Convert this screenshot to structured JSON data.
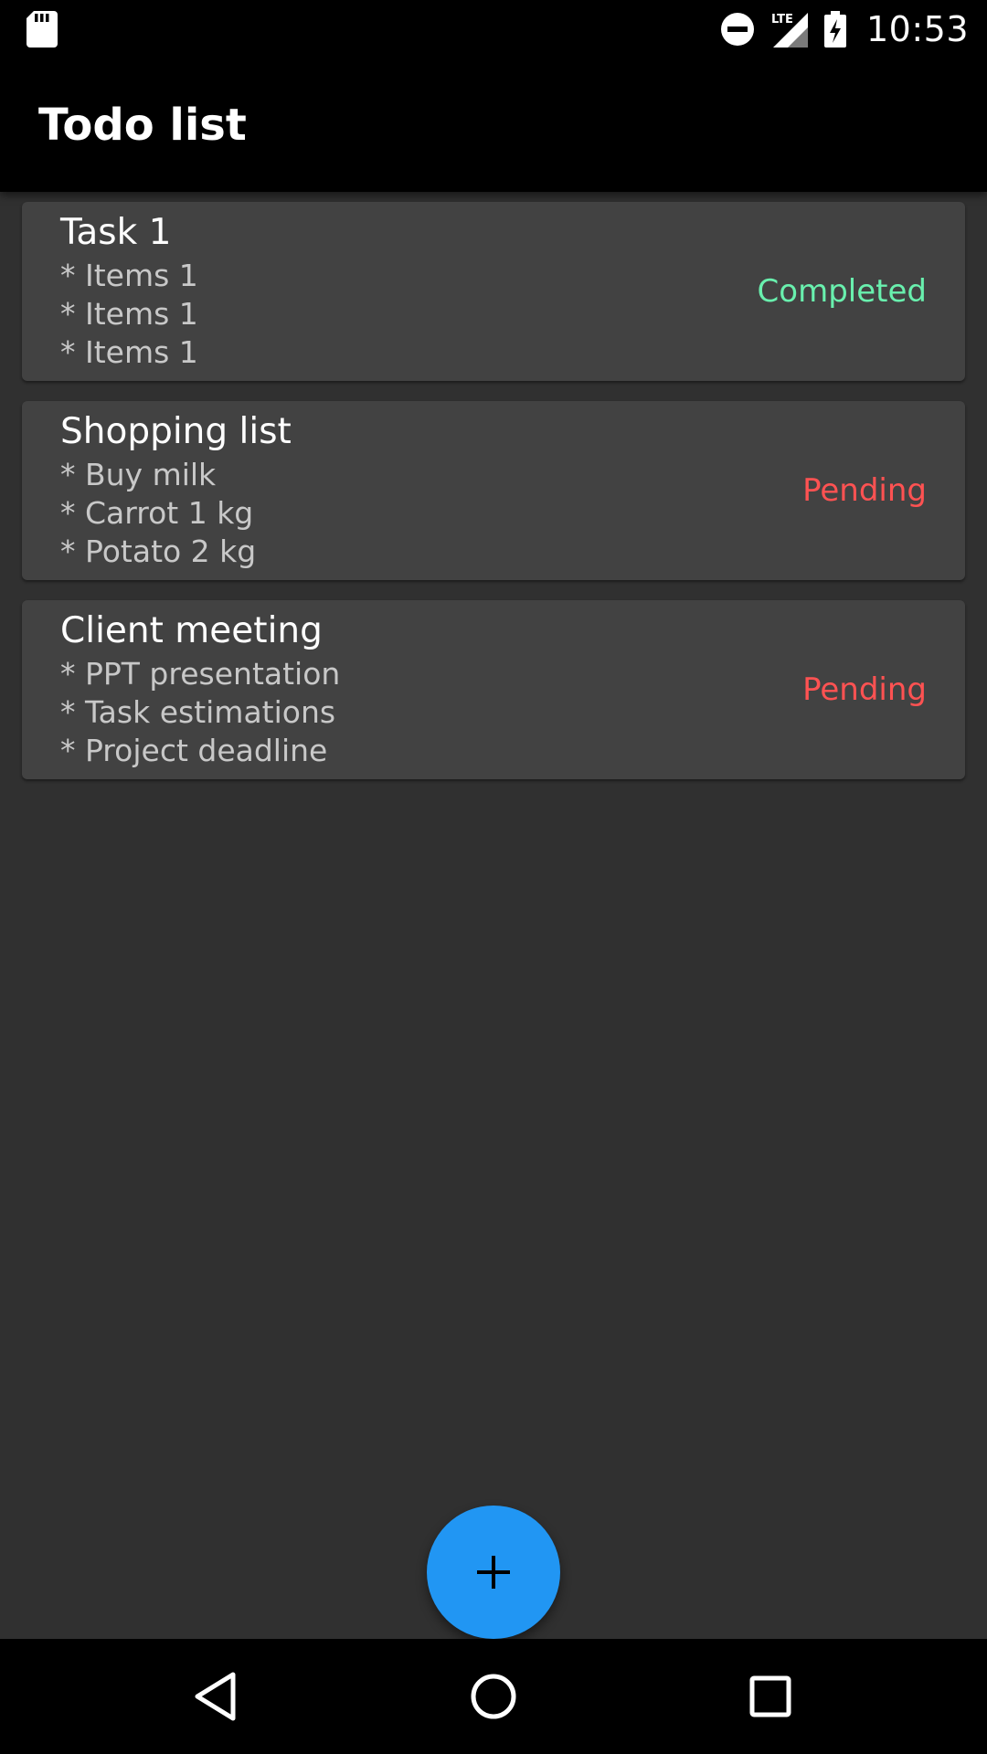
{
  "status_bar": {
    "time": "10:53",
    "network": "LTE",
    "icons": [
      "sd-card-icon",
      "do-not-disturb-icon",
      "signal-icon",
      "battery-charging-icon"
    ]
  },
  "app_bar": {
    "title": "Todo list"
  },
  "tasks": [
    {
      "title": "Task 1",
      "items": [
        "* Items 1",
        "* Items 1",
        "* Items 1"
      ],
      "status": "Completed",
      "status_color": "#69f0ae"
    },
    {
      "title": "Shopping list",
      "items": [
        "* Buy milk",
        "* Carrot 1 kg",
        "* Potato 2 kg"
      ],
      "status": "Pending",
      "status_color": "#ff5252"
    },
    {
      "title": "Client meeting",
      "items": [
        "* PPT presentation",
        "* Task estimations",
        "* Project deadline"
      ],
      "status": "Pending",
      "status_color": "#ff5252"
    }
  ],
  "fab": {
    "icon": "plus-icon",
    "color": "#2196f3"
  },
  "nav_bar": {
    "icons": [
      "back-icon",
      "home-icon",
      "recents-icon"
    ]
  }
}
